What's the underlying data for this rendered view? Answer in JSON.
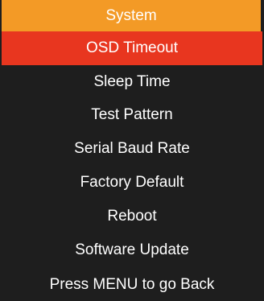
{
  "menu": {
    "title": "System",
    "items": [
      {
        "label": "OSD Timeout",
        "selected": true
      },
      {
        "label": "Sleep Time",
        "selected": false
      },
      {
        "label": "Test Pattern",
        "selected": false
      },
      {
        "label": "Serial Baud Rate",
        "selected": false
      },
      {
        "label": "Factory Default",
        "selected": false
      },
      {
        "label": "Reboot",
        "selected": false
      },
      {
        "label": "Software Update",
        "selected": false
      }
    ],
    "footer_hint": "Press MENU to go Back"
  },
  "colors": {
    "background": "#1e1e1e",
    "header": "#f39a26",
    "selection": "#e8361f",
    "text": "#ffffff"
  }
}
